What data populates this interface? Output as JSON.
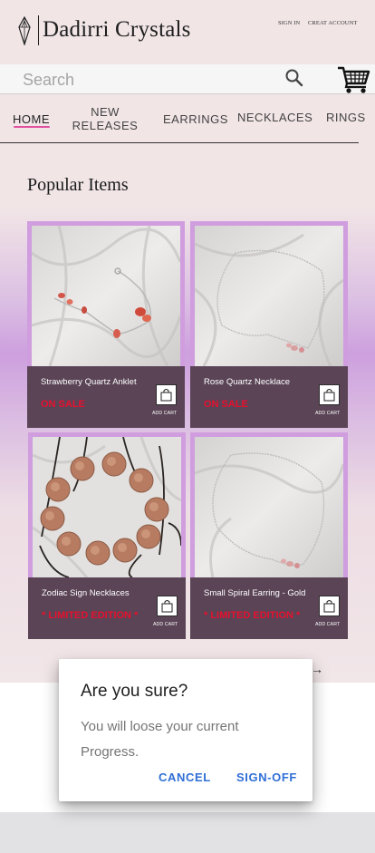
{
  "header": {
    "brand": "Dadirri Crystals",
    "sign_in": "SIGN IN",
    "create_account": "CREAT ACCOUNT"
  },
  "search": {
    "placeholder": "Search"
  },
  "nav": {
    "home": "HOME",
    "new_releases": "NEW RELEASES",
    "earrings": "EARRINGS",
    "necklaces": "NECKLACES",
    "rings": "RINGS"
  },
  "section_title": "Popular Items",
  "products": [
    {
      "name": "Strawberry Quartz Anklet",
      "tag": "ON SALE",
      "add_cart": "ADD CART"
    },
    {
      "name": "Rose Quartz Necklace",
      "tag": "ON SALE",
      "add_cart": "ADD CART"
    },
    {
      "name": "Zodiac Sign Necklaces",
      "tag": "* LIMITED EDITION *",
      "add_cart": "ADD CART"
    },
    {
      "name": "Small Spiral Earring - Gold",
      "tag": "* LIMITED EDITION *",
      "add_cart": "ADD CART"
    }
  ],
  "next_arrow": "→",
  "dialog": {
    "title": "Are you sure?",
    "body": "You will loose your current Progress.",
    "cancel": "CANCEL",
    "confirm": "SIGN-OFF"
  },
  "colors": {
    "card_frame": "#d09ddf",
    "card_info": "#5a4456",
    "tag_red": "#e8102e",
    "nav_underline": "#e0509e",
    "dialog_button": "#2f6fd6"
  },
  "icons": [
    "crystal-logo-icon",
    "search-icon",
    "cart-icon",
    "shopping-bag-icon",
    "arrow-right-icon"
  ]
}
